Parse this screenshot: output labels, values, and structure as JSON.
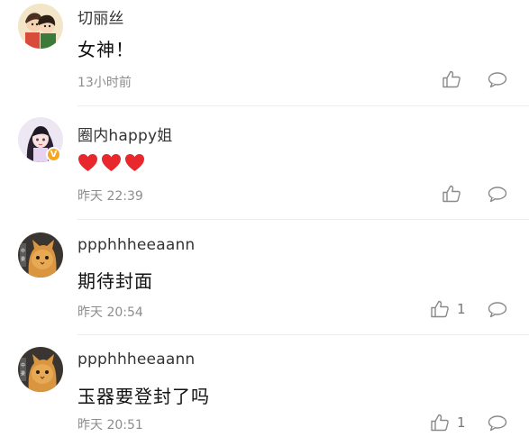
{
  "comments": [
    {
      "username": "切丽丝",
      "content": "女神！",
      "time": "13小时前",
      "like_count": "",
      "avatar_icon": "couple-cartoon-avatar"
    },
    {
      "username": "圈内happy姐",
      "content": "",
      "content_icons": [
        "red-heart-icon",
        "red-heart-icon",
        "red-heart-icon"
      ],
      "time": "昨天 22:39",
      "like_count": "",
      "avatar_icon": "anime-girl-avatar",
      "badge_text": "V"
    },
    {
      "username": "ppphhheeaann",
      "content": "期待封面",
      "time": "昨天 20:54",
      "like_count": "1",
      "avatar_icon": "orange-cat-avatar"
    },
    {
      "username": "ppphhheeaann",
      "content": "玉器要登封了吗",
      "time": "昨天 20:51",
      "like_count": "1",
      "avatar_icon": "orange-cat-avatar"
    }
  ],
  "colors": {
    "text_primary": "#111111",
    "text_secondary": "#8d8d8d",
    "heart": "#e8282c",
    "badge": "#f5a623",
    "divider": "#ececec"
  }
}
